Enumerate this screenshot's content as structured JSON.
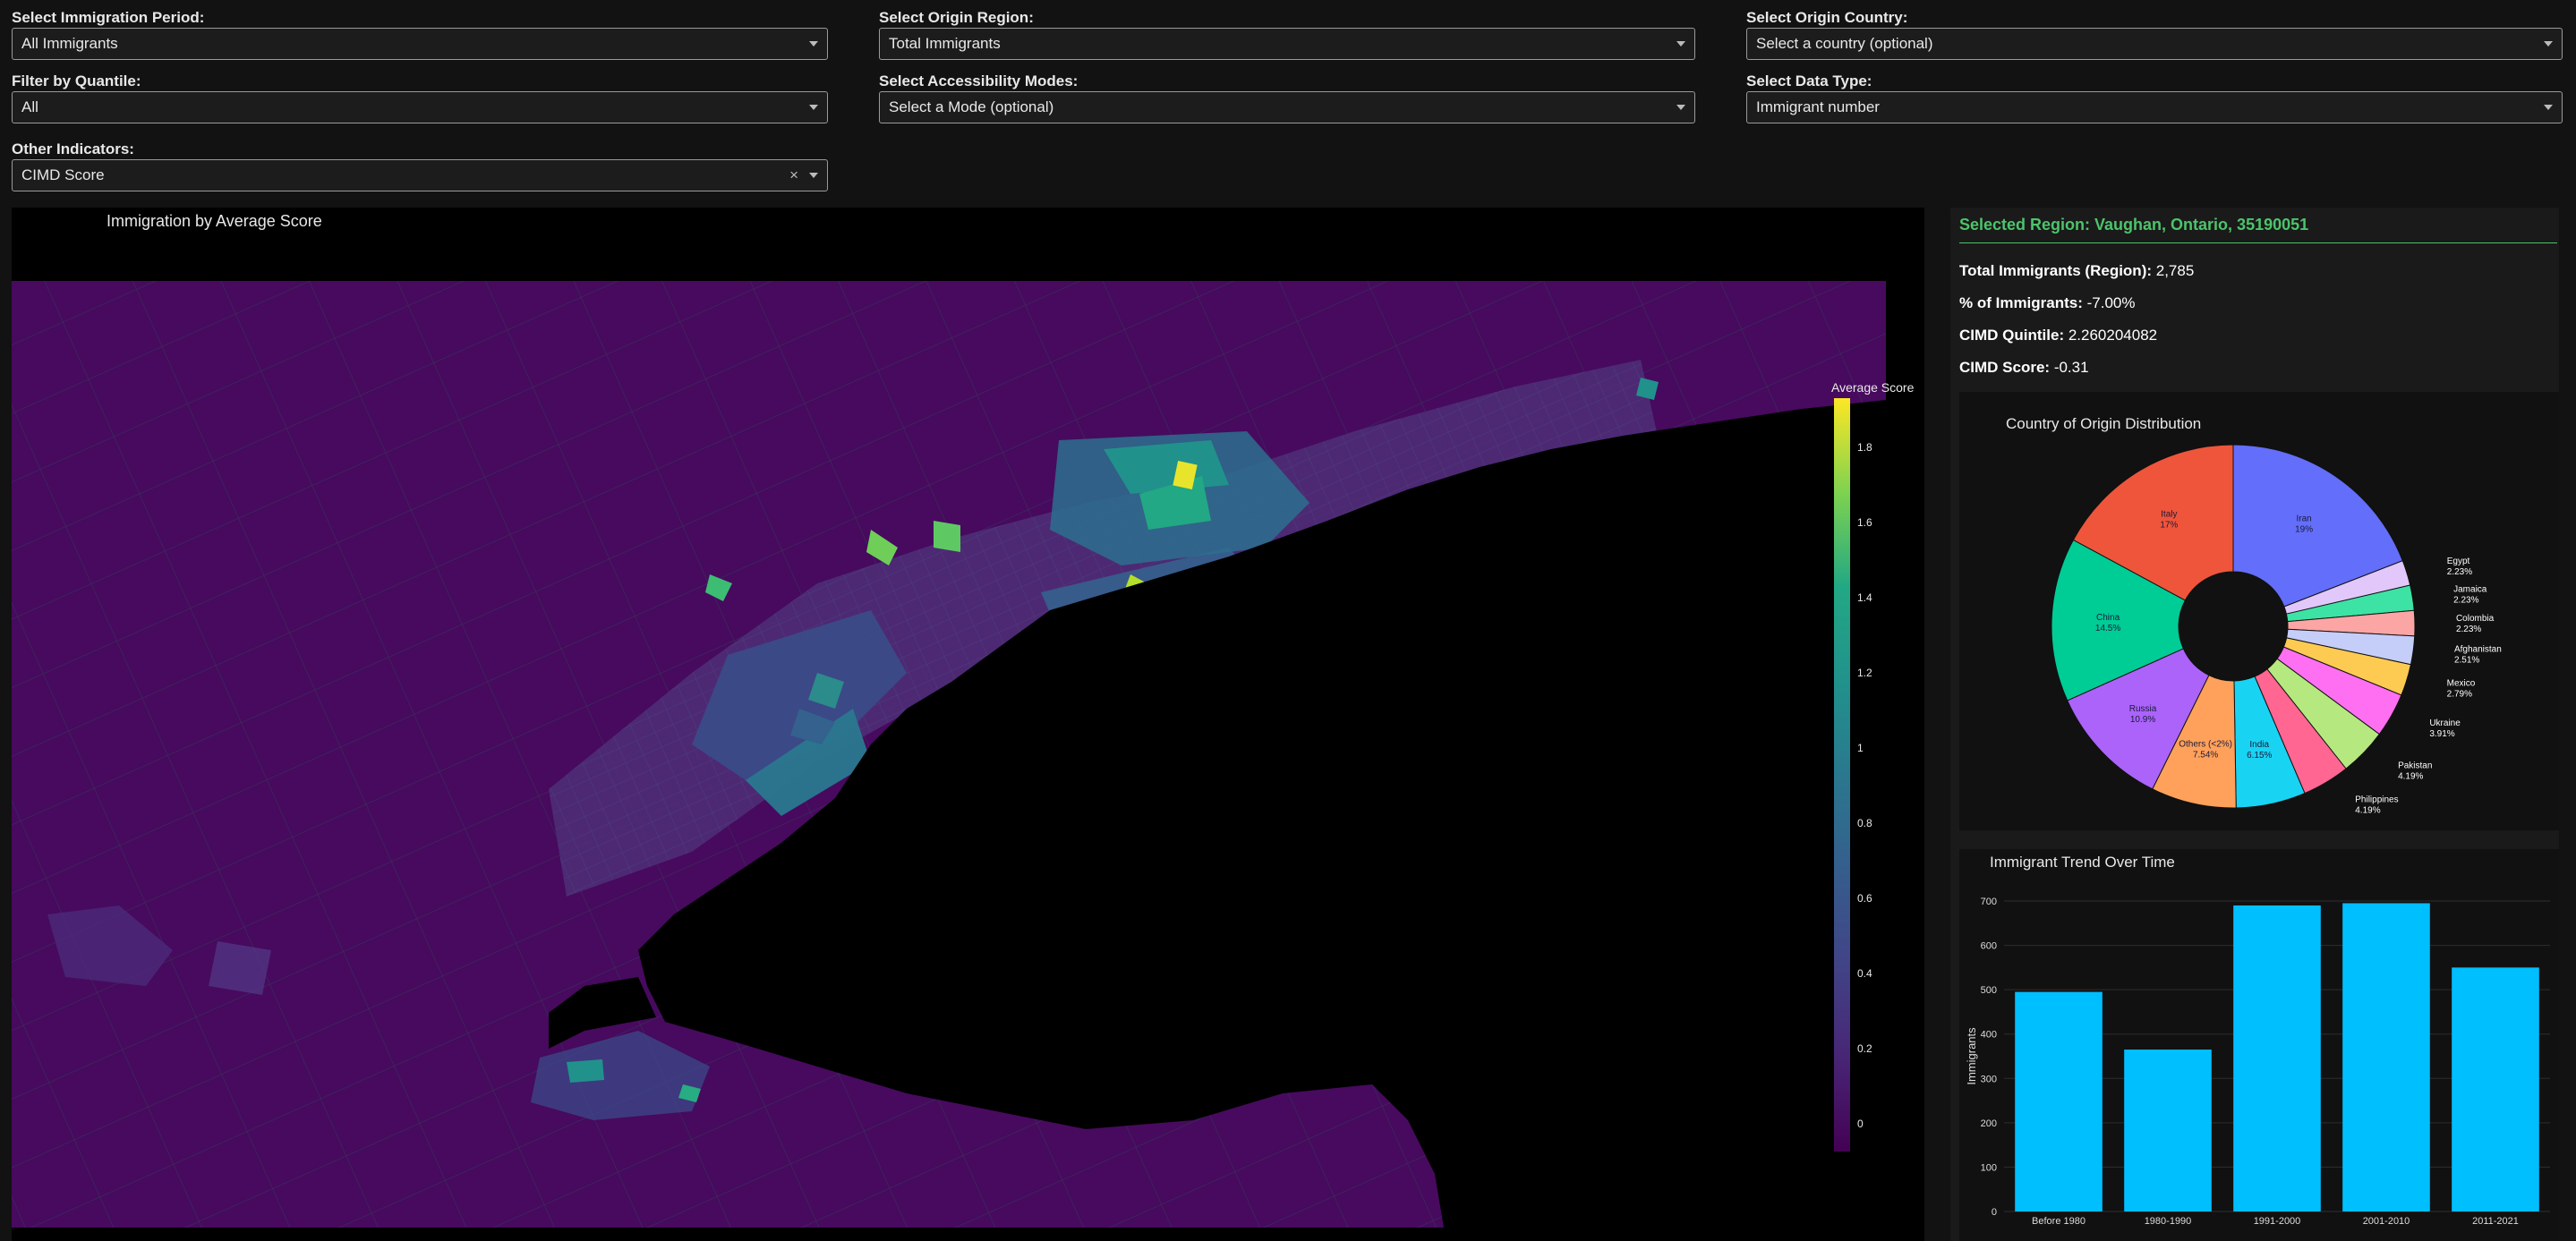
{
  "filters": {
    "period": {
      "label": "Select Immigration Period:",
      "value": "All Immigrants"
    },
    "origin_region": {
      "label": "Select Origin Region:",
      "value": "Total Immigrants"
    },
    "origin_country": {
      "label": "Select Origin Country:",
      "value": "Select a country (optional)"
    },
    "quantile": {
      "label": "Filter by Quantile:",
      "value": "All"
    },
    "access_modes": {
      "label": "Select Accessibility Modes:",
      "value": "Select a Mode (optional)"
    },
    "data_type": {
      "label": "Select Data Type:",
      "value": "Immigrant number"
    },
    "other": {
      "label": "Other Indicators:",
      "value": "CIMD Score",
      "clear": "×"
    }
  },
  "map": {
    "title": "Immigration by Average Score",
    "colorbar_title": "Average Score",
    "colorbar_ticks": [
      "1.8",
      "1.6",
      "1.4",
      "1.2",
      "1",
      "0.8",
      "0.6",
      "0.4",
      "0.2",
      "0"
    ]
  },
  "region": {
    "title": "Selected Region: Vaughan, Ontario, 35190051",
    "stats": [
      {
        "label": "Total Immigrants (Region):",
        "value": "2,785"
      },
      {
        "label": "% of Immigrants:",
        "value": "-7.00%"
      },
      {
        "label": "CIMD Quintile:",
        "value": "2.260204082"
      },
      {
        "label": "CIMD Score:",
        "value": "-0.31"
      }
    ]
  },
  "chart_data": [
    {
      "type": "pie",
      "title": "Country of Origin Distribution",
      "slices": [
        {
          "label": "Iran",
          "pct": "19%",
          "value": 19.0,
          "color": "#636efa"
        },
        {
          "label": "Egypt",
          "pct": "2.23%",
          "value": 2.23,
          "color": "#e2c7fb"
        },
        {
          "label": "Jamaica",
          "pct": "2.23%",
          "value": 2.23,
          "color": "#3de3a4"
        },
        {
          "label": "Colombia",
          "pct": "2.23%",
          "value": 2.23,
          "color": "#fca5a5"
        },
        {
          "label": "Afghanistan",
          "pct": "2.51%",
          "value": 2.51,
          "color": "#c5cdf9"
        },
        {
          "label": "Mexico",
          "pct": "2.79%",
          "value": 2.79,
          "color": "#fecb52"
        },
        {
          "label": "Ukraine",
          "pct": "3.91%",
          "value": 3.91,
          "color": "#ff6ff2"
        },
        {
          "label": "Pakistan",
          "pct": "4.19%",
          "value": 4.19,
          "color": "#b6e880"
        },
        {
          "label": "Philippines",
          "pct": "4.19%",
          "value": 4.19,
          "color": "#ff6692"
        },
        {
          "label": "India",
          "pct": "6.15%",
          "value": 6.15,
          "color": "#19d3f3"
        },
        {
          "label": "Others (<2%)",
          "pct": "7.54%",
          "value": 7.54,
          "color": "#ffa15a"
        },
        {
          "label": "Russia",
          "pct": "10.9%",
          "value": 10.9,
          "color": "#ab63fa"
        },
        {
          "label": "China",
          "pct": "14.5%",
          "value": 14.5,
          "color": "#00cc96"
        },
        {
          "label": "Italy",
          "pct": "17%",
          "value": 17.0,
          "color": "#ef553b"
        }
      ]
    },
    {
      "type": "bar",
      "title": "Immigrant Trend Over Time",
      "ylabel": "Immigrants",
      "categories": [
        "Before 1980",
        "1980-1990",
        "1991-2000",
        "2001-2010",
        "2011-2021"
      ],
      "values": [
        495,
        365,
        690,
        695,
        550
      ],
      "ylim": [
        0,
        700
      ],
      "yticks": [
        "0",
        "100",
        "200",
        "300",
        "400",
        "500",
        "600",
        "700"
      ],
      "color": "#00bfff"
    }
  ]
}
